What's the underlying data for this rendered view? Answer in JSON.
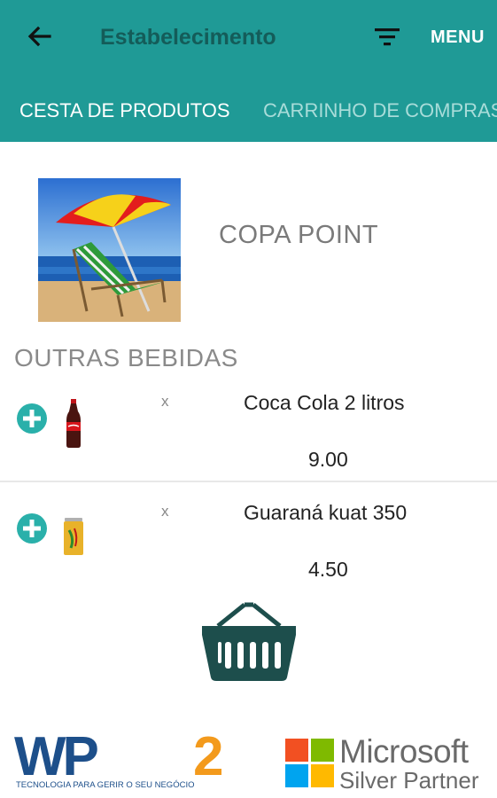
{
  "header": {
    "title": "Estabelecimento",
    "menu_label": "MENU",
    "color": "#1f9a96"
  },
  "tabs": [
    {
      "label": "CESTA DE PRODUTOS",
      "active": true
    },
    {
      "label": "CARRINHO DE COMPRAS",
      "active": false
    }
  ],
  "store": {
    "name": "COPA POINT",
    "image": "beach-umbrella-chair"
  },
  "section": {
    "title": "OUTRAS BEBIDAS"
  },
  "products": [
    {
      "name": "Coca Cola 2 litros",
      "price": "9.00",
      "qty_marker": "x",
      "image": "cola-bottle"
    },
    {
      "name": "Guaraná kuat 350",
      "price": "4.50",
      "qty_marker": "x",
      "image": "guarana-can"
    }
  ],
  "footer": {
    "wp2_logo": "WP2",
    "wp2_tagline": "TECNOLOGIA PARA GERIR O SEU NEGÓCIO",
    "partner_line1": "Microsoft",
    "partner_line2": "Silver Partner"
  }
}
